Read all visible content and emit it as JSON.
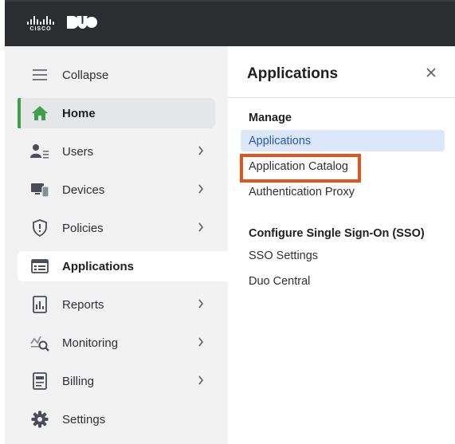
{
  "header": {
    "cisco_logo_text": "CISCO",
    "duo_logo_text": "DUO"
  },
  "sidebar": {
    "items": [
      {
        "label": "Collapse",
        "icon": "hamburger-icon"
      },
      {
        "label": "Home",
        "icon": "home-icon",
        "state": "selected"
      },
      {
        "label": "Users",
        "icon": "users-icon",
        "has_submenu": true
      },
      {
        "label": "Devices",
        "icon": "devices-icon",
        "has_submenu": true
      },
      {
        "label": "Policies",
        "icon": "shield-icon",
        "has_submenu": true
      },
      {
        "label": "Applications",
        "icon": "applications-icon",
        "state": "open"
      },
      {
        "label": "Reports",
        "icon": "reports-icon",
        "has_submenu": true
      },
      {
        "label": "Monitoring",
        "icon": "monitoring-icon",
        "has_submenu": true
      },
      {
        "label": "Billing",
        "icon": "billing-icon",
        "has_submenu": true
      },
      {
        "label": "Settings",
        "icon": "gear-icon"
      }
    ]
  },
  "flyout": {
    "title": "Applications",
    "sections": [
      {
        "heading": "Manage",
        "links": [
          "Applications",
          "Application Catalog",
          "Authentication Proxy"
        ]
      },
      {
        "heading": "Configure Single Sign-On (SSO)",
        "links": [
          "SSO Settings",
          "Duo Central"
        ]
      }
    ],
    "active_link": "Applications",
    "highlighted_link": "Application Catalog"
  },
  "colors": {
    "topbar": "#2b2d31",
    "sidebar_bg": "#f2f2f3",
    "home_accent": "#3ea04b",
    "active_link_bg": "#dce7fa",
    "active_link_text": "#2457c5",
    "highlight_border": "#e2541b"
  }
}
